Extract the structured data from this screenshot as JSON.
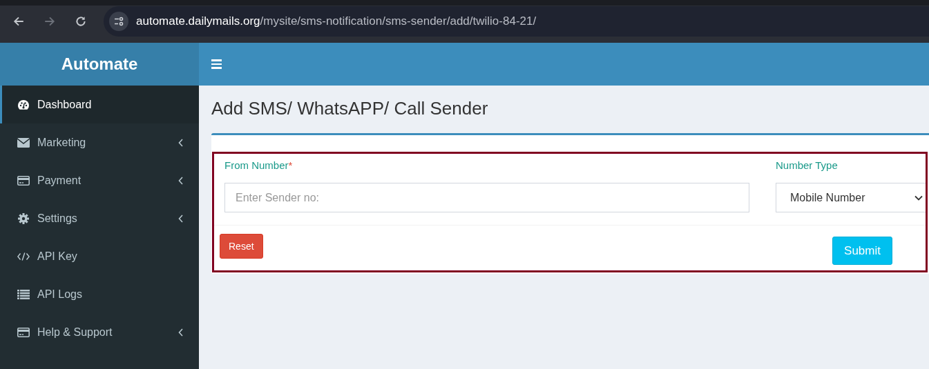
{
  "browser": {
    "url_host": "automate.dailymails.org",
    "url_path": "/mysite/sms-notification/sms-sender/add/twilio-84-21/"
  },
  "brand": "Automate",
  "sidebar": {
    "items": [
      {
        "kind": "gauge",
        "label": "Dashboard",
        "submenu": false,
        "selected": true
      },
      {
        "kind": "envelope",
        "label": "Marketing",
        "submenu": true,
        "selected": false
      },
      {
        "kind": "card",
        "label": "Payment",
        "submenu": true,
        "selected": false
      },
      {
        "kind": "gear",
        "label": "Settings",
        "submenu": true,
        "selected": false
      },
      {
        "kind": "code",
        "label": "API Key",
        "submenu": false,
        "selected": false
      },
      {
        "kind": "list",
        "label": "API Logs",
        "submenu": false,
        "selected": false
      },
      {
        "kind": "card",
        "label": "Help & Support",
        "submenu": true,
        "selected": false
      }
    ]
  },
  "page_title": "Add SMS/ WhatsAPP/ Call Sender",
  "form": {
    "highlighted": true,
    "from_number": {
      "label": "From Number",
      "required_mark": "*",
      "placeholder": "Enter Sender no:"
    },
    "number_type": {
      "label": "Number Type",
      "value": "Mobile Number"
    },
    "buttons": [
      {
        "kind": "reset",
        "label": "Reset"
      },
      {
        "kind": "submit",
        "label": "Submit"
      }
    ]
  }
}
